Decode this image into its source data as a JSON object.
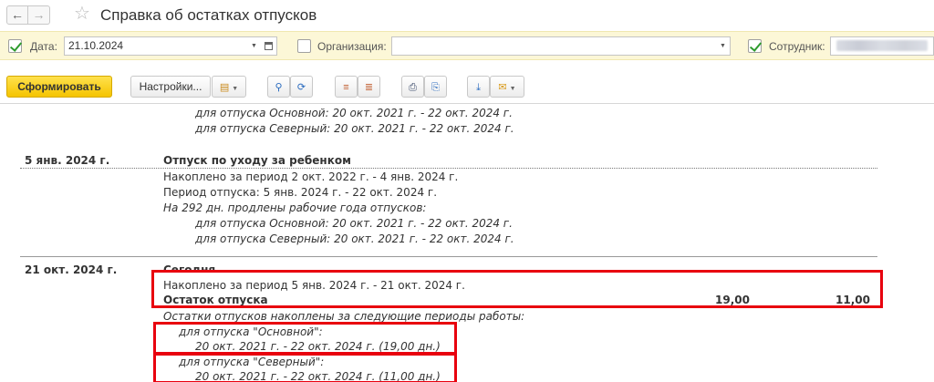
{
  "window": {
    "title": "Справка об остатках отпусков"
  },
  "filters": {
    "date_label": "Дата:",
    "date_value": "21.10.2024",
    "organization_label": "Организация:",
    "organization_value": "",
    "employee_label": "Сотрудник:"
  },
  "toolbar": {
    "generate_label": "Сформировать",
    "settings_label": "Настройки..."
  },
  "report": {
    "top": {
      "line1": "для отпуска Основной: 20 окт. 2021 г. - 22 окт. 2024 г.",
      "line2": "для отпуска Северный: 20 окт. 2021 г. - 22 окт. 2024 г."
    },
    "block1": {
      "date": "5 янв. 2024 г.",
      "heading": "Отпуск по уходу за ребенком",
      "accrued": "Накоплено за период 2 окт. 2022 г. - 4 янв. 2024 г.",
      "period": "Период отпуска: 5 янв. 2024 г. - 22 окт. 2024 г.",
      "extended": "На 292 дн. продлены рабочие года отпусков:",
      "main": "для отпуска Основной: 20 окт. 2021 г. - 22 окт. 2024 г.",
      "north": "для отпуска Северный: 20 окт. 2021 г. - 22 окт. 2024 г."
    },
    "block2": {
      "date": "21 окт. 2024 г.",
      "heading": "Сегодня",
      "accrued": "Накоплено за период 5 янв. 2024 г. - 21 окт. 2024 г.",
      "balance_label": "Остаток отпуска",
      "balance_value1": "19,00",
      "balance_value2": "11,00",
      "periods_note": "Остатки отпусков накоплены за следующие периоды работы:",
      "main_label": "для отпуска \"Основной\":",
      "main_period": "20 окт. 2021 г. - 22 окт. 2024 г. (19,00 дн.)",
      "north_label": "для отпуска \"Северный\":",
      "north_period": "20 окт. 2021 г. - 22 окт. 2024 г. (11,00 дн.)"
    }
  }
}
